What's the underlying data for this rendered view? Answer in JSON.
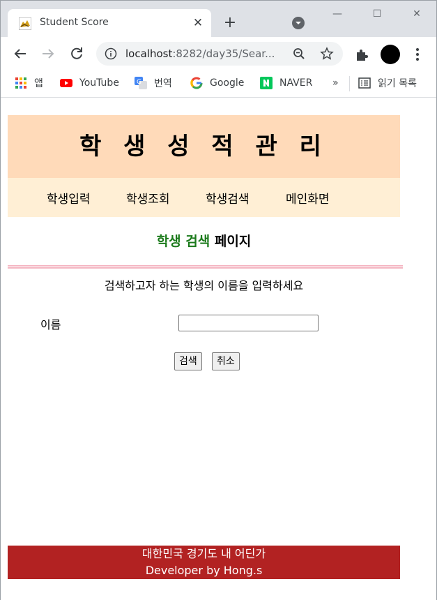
{
  "browser": {
    "tab_title": "Student Score",
    "tab_close": "✕",
    "new_tab": "+",
    "url_host": "localhost",
    "url_rest": ":8282/day35/Sear...",
    "window_controls": {
      "minimize": "—",
      "maximize": "☐",
      "close": "✕"
    }
  },
  "bookmarks": {
    "apps": "앱",
    "youtube": "YouTube",
    "translate": "번역",
    "google": "Google",
    "naver": "NAVER",
    "more": "»",
    "reading_list": "읽기 목록"
  },
  "page": {
    "header_title": "학 생 성 적 관 리",
    "nav": [
      "학생입력",
      "학생조회",
      "학생검색",
      "메인화면"
    ],
    "subtitle_green": "학생 검색",
    "subtitle_rest": " 페이지",
    "instruction": "검색하고자 하는 학생의 이름을 입력하세요",
    "name_label": "이름",
    "name_value": "",
    "search_button": "검색",
    "cancel_button": "취소",
    "footer_line1": "대한민국 경기도 내 어딘가",
    "footer_line2": "Developer by Hong.s"
  },
  "colors": {
    "header_bg": "#ffdab9",
    "nav_bg": "#ffefd5",
    "subtitle_green": "#1b7a1b",
    "divider_pink": "#f4b6c2",
    "footer_bg": "#b22222"
  }
}
